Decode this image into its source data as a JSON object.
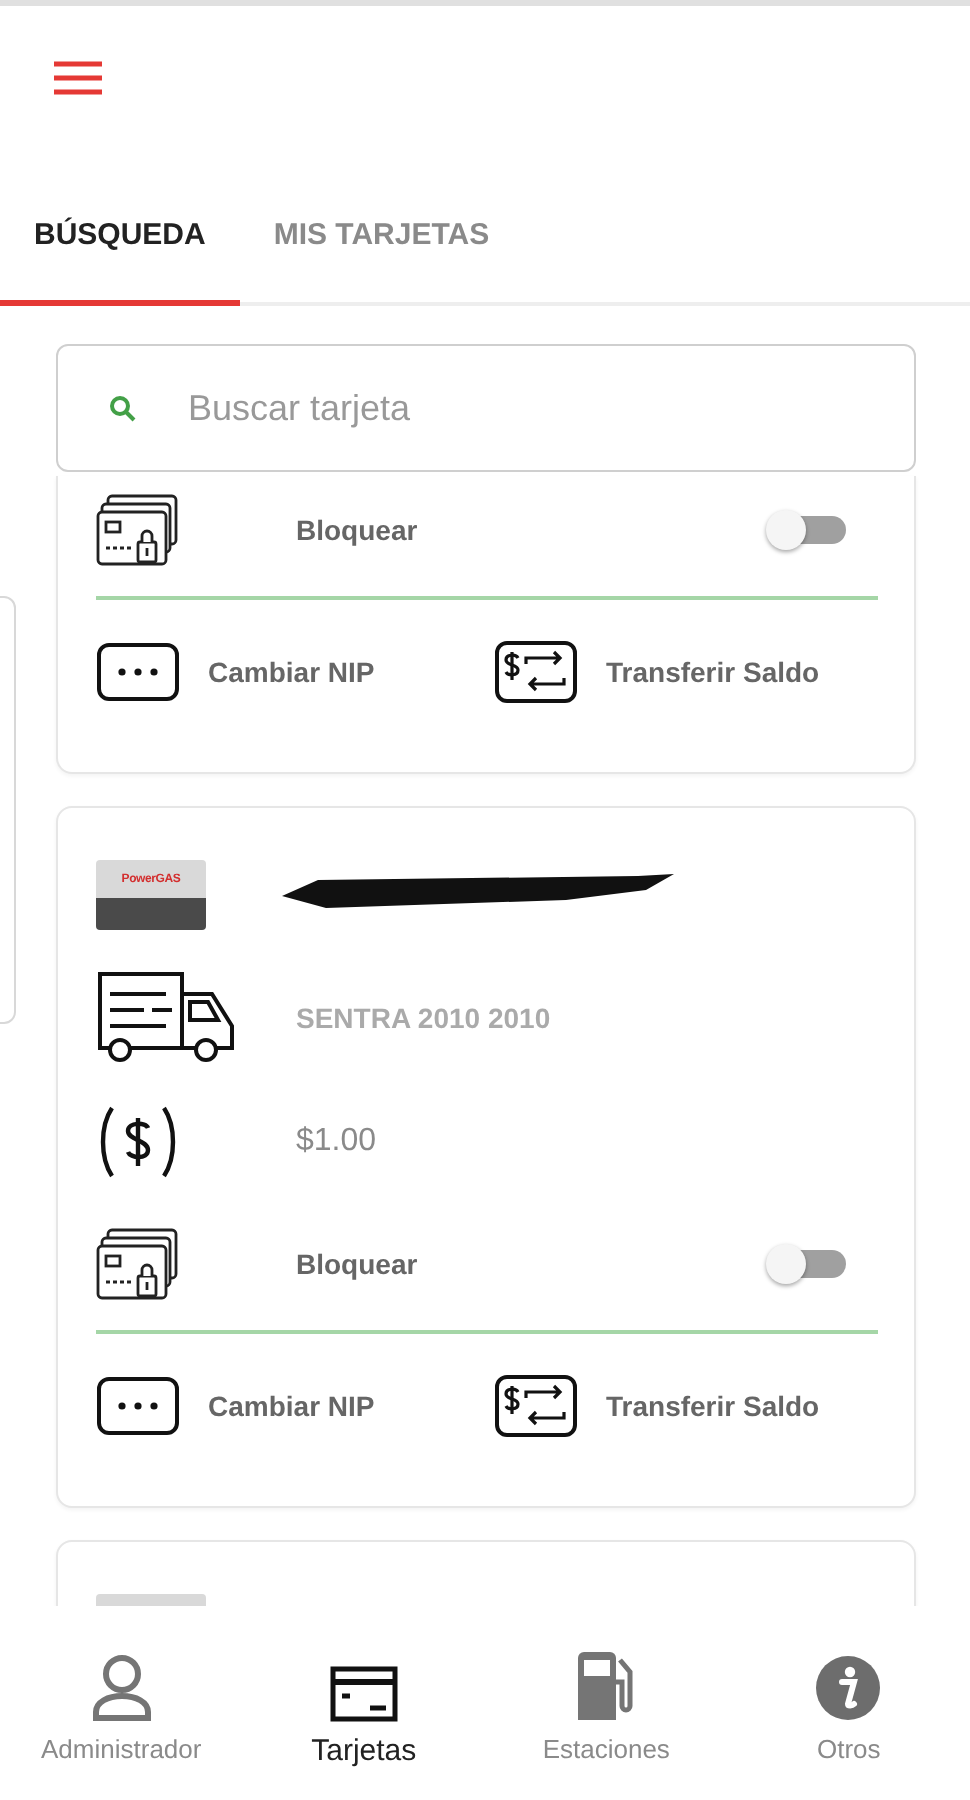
{
  "tabs": [
    {
      "label": "BÚSQUEDA",
      "selected": true
    },
    {
      "label": "MIS TARJETAS",
      "selected": false
    }
  ],
  "search": {
    "placeholder": "Buscar tarjeta"
  },
  "cards": [
    {
      "cut_top": true,
      "lock": {
        "label": "Bloquear",
        "on": false
      },
      "actions": [
        "Cambiar NIP",
        "Transferir Saldo"
      ]
    },
    {
      "cut_top": false,
      "thumbnail": true,
      "logo_text": "PowerGAS",
      "number_redacted": true,
      "vehicle": "SENTRA 2010 2010",
      "balance": "$1.00",
      "lock": {
        "label": "Bloquear",
        "on": false
      },
      "actions": [
        "Cambiar NIP",
        "Transferir Saldo"
      ]
    },
    {
      "cut_top": false,
      "thumbnail": true
    }
  ],
  "bottom_nav": [
    {
      "kind": "person",
      "label": "Administrador",
      "selected": false
    },
    {
      "kind": "card",
      "label": "Tarjetas",
      "selected": true
    },
    {
      "kind": "fuel",
      "label": "Estaciones",
      "selected": false
    },
    {
      "kind": "info",
      "label": "Otros",
      "selected": false
    }
  ]
}
